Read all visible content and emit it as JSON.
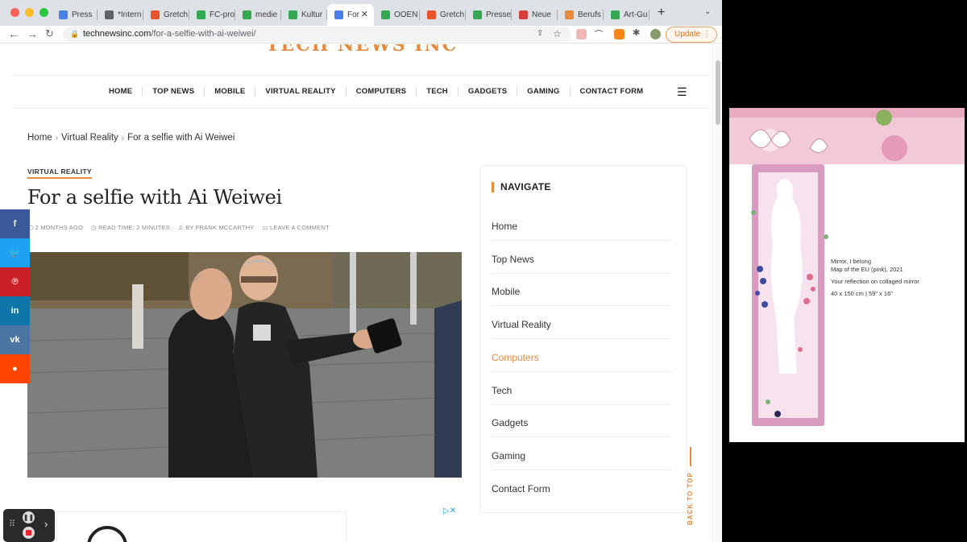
{
  "browser": {
    "tabs": [
      {
        "label": "Press",
        "color": "#4a7ee8"
      },
      {
        "label": "*Intern",
        "color": "#5f6368"
      },
      {
        "label": "Gretch",
        "color": "#e8542c"
      },
      {
        "label": "FC-pro",
        "color": "#34a853"
      },
      {
        "label": "medie",
        "color": "#34a853"
      },
      {
        "label": "Kultur",
        "color": "#34a853"
      },
      {
        "label": "For",
        "color": "#4a7ee8",
        "active": true
      },
      {
        "label": "OOEN",
        "color": "#34a853"
      },
      {
        "label": "Gretch",
        "color": "#e8542c"
      },
      {
        "label": "Presse",
        "color": "#34a853"
      },
      {
        "label": "Neue",
        "color": "#d93c3c"
      },
      {
        "label": "Berufs",
        "color": "#e8893c"
      },
      {
        "label": "Art-Gu",
        "color": "#34a853"
      }
    ],
    "url_host": "technewsinc.com",
    "url_path": "/for-a-selfie-with-ai-weiwei/",
    "update_label": "Update"
  },
  "site": {
    "logo": "TECH NEWS INC",
    "nav": [
      "HOME",
      "TOP NEWS",
      "MOBILE",
      "VIRTUAL REALITY",
      "COMPUTERS",
      "TECH",
      "GADGETS",
      "GAMING",
      "CONTACT FORM"
    ]
  },
  "breadcrumb": {
    "home": "Home",
    "category": "Virtual Reality",
    "current": "For a selfie with Ai Weiwei"
  },
  "post": {
    "category": "VIRTUAL REALITY",
    "title": "For a selfie with Ai Weiwei",
    "date": "2 MONTHS AGO",
    "read_time": "READ TIME: 2 MINUTES",
    "author": "BY FRANK MCCARTHY",
    "comment": "LEAVE A COMMENT"
  },
  "social": [
    {
      "icon": "f",
      "color": "#3b5998"
    },
    {
      "icon": "t",
      "color": "#1da1f2"
    },
    {
      "icon": "p",
      "color": "#cb2027"
    },
    {
      "icon": "in",
      "color": "#0e76a8"
    },
    {
      "icon": "vk",
      "color": "#4c75a3"
    },
    {
      "icon": "rd",
      "color": "#ff4500"
    }
  ],
  "sidebar": {
    "title": "NAVIGATE",
    "items": [
      "Home",
      "Top News",
      "Mobile",
      "Virtual Reality",
      "Computers",
      "Tech",
      "Gadgets",
      "Gaming",
      "Contact Form"
    ],
    "active_color": "#e8893c",
    "active_item": "Computers"
  },
  "back_to_top": "BACK TO TOP",
  "artwork": {
    "line1": "Mirror, I belong",
    "line2": "Map of the EU (pink), 2021",
    "line3": "Your reflection on collaged mirror",
    "line4": "40 x 150 cm |  59\"  x  16\""
  }
}
